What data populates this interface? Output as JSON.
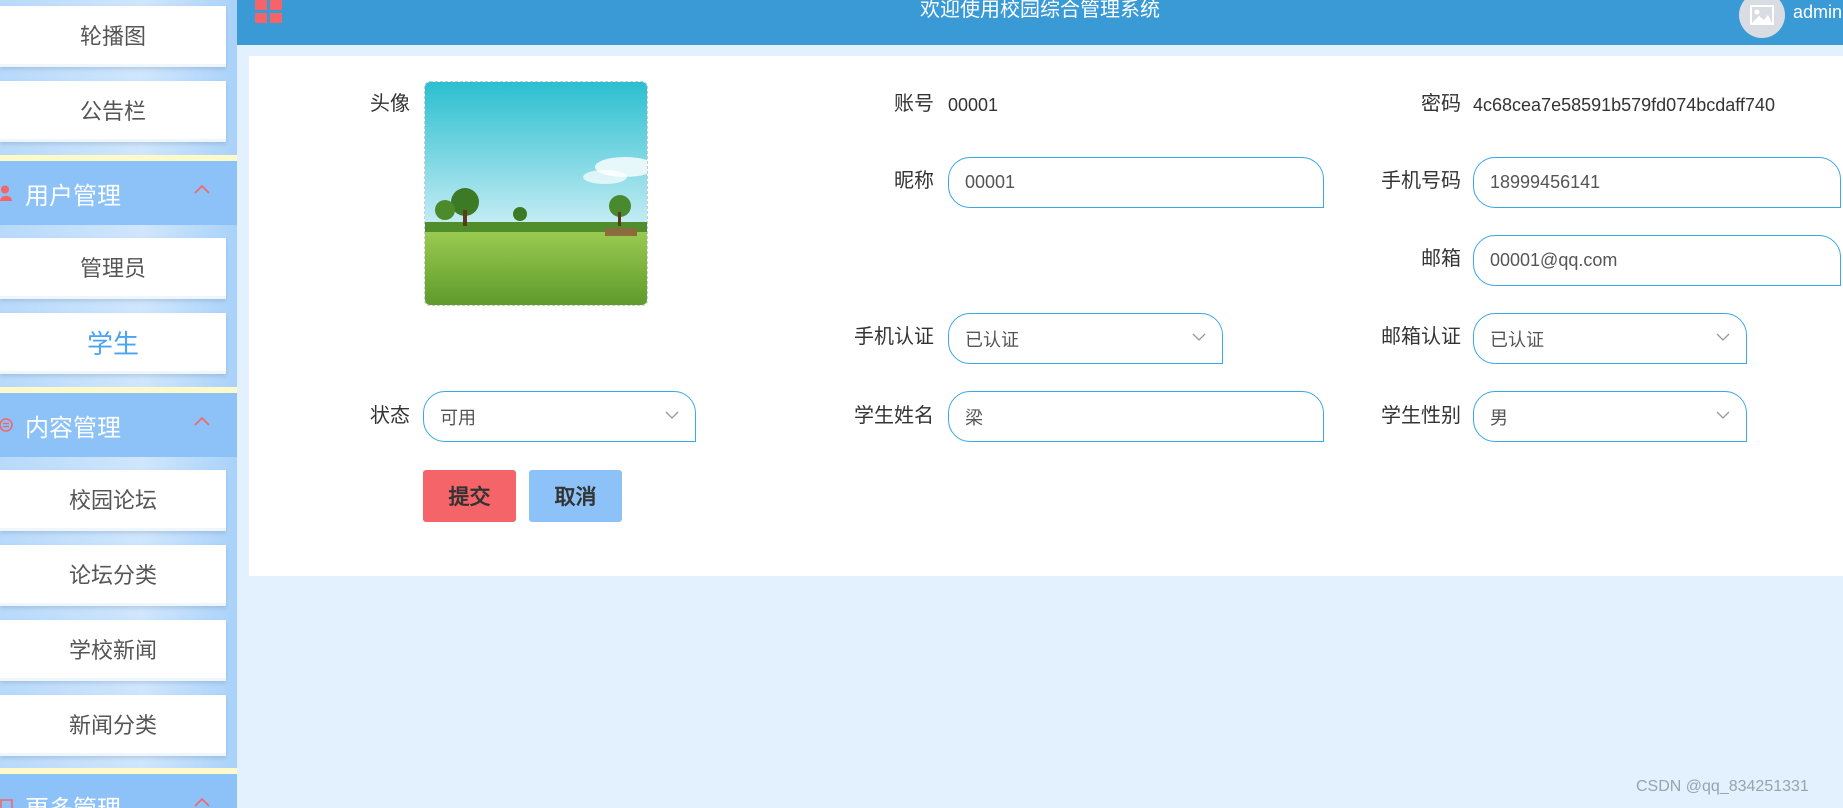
{
  "header": {
    "title": "欢迎使用校园综合管理系统",
    "username": "admin"
  },
  "sidebar": {
    "items": [
      {
        "label": "轮播图"
      },
      {
        "label": "公告栏"
      },
      {
        "label": "管理员"
      },
      {
        "label": "学生",
        "active": true
      },
      {
        "label": "校园论坛"
      },
      {
        "label": "论坛分类"
      },
      {
        "label": "学校新闻"
      },
      {
        "label": "新闻分类"
      }
    ],
    "groups": [
      {
        "label": "用户管理",
        "icon": "user-icon"
      },
      {
        "label": "内容管理",
        "icon": "content-icon"
      },
      {
        "label": "更多管理",
        "icon": "more-icon"
      }
    ]
  },
  "form": {
    "avatar_label": "头像",
    "account_label": "账号",
    "account_value": "00001",
    "password_label": "密码",
    "password_value": "4c68cea7e58591b579fd074bcdaff740",
    "nickname_label": "昵称",
    "nickname_value": "00001",
    "phone_label": "手机号码",
    "phone_value": "18999456141",
    "email_label": "邮箱",
    "email_value": "00001@qq.com",
    "phone_verify_label": "手机认证",
    "phone_verify_value": "已认证",
    "email_verify_label": "邮箱认证",
    "email_verify_value": "已认证",
    "status_label": "状态",
    "status_value": "可用",
    "student_name_label": "学生姓名",
    "student_name_value": "梁",
    "student_gender_label": "学生性别",
    "student_gender_value": "男",
    "submit_label": "提交",
    "cancel_label": "取消"
  },
  "colors": {
    "header": "#3a9ad6",
    "accent": "#3aa7e6",
    "submit": "#f56468",
    "cancel": "#8cc2f7",
    "sidebar_group": "#8cc2f7"
  },
  "watermark": "CSDN @qq_834251331"
}
